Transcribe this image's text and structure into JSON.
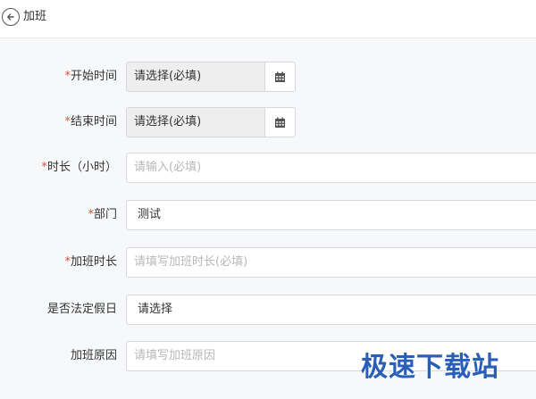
{
  "header": {
    "title": "加班"
  },
  "form": {
    "start_time": {
      "label": "开始时间",
      "required": "*",
      "placeholder": "请选择(必填)"
    },
    "end_time": {
      "label": "结束时间",
      "required": "*",
      "placeholder": "请选择(必填)"
    },
    "duration": {
      "label": "时长（小时）",
      "required": "*",
      "placeholder": "请输入(必填)"
    },
    "department": {
      "label": "部门",
      "required": "*",
      "value": "测试"
    },
    "overtime_duration": {
      "label": "加班时长",
      "required": "*",
      "placeholder": "请填写加班时长(必填)"
    },
    "holiday": {
      "label": "是否法定假日",
      "value": "请选择"
    },
    "reason": {
      "label": "加班原因",
      "placeholder": "请填写加班原因"
    },
    "next_label": {
      "label": ""
    }
  },
  "watermark": "极速下载站",
  "icons": {
    "back": "arrow-left-icon",
    "calendar": "calendar-icon"
  }
}
